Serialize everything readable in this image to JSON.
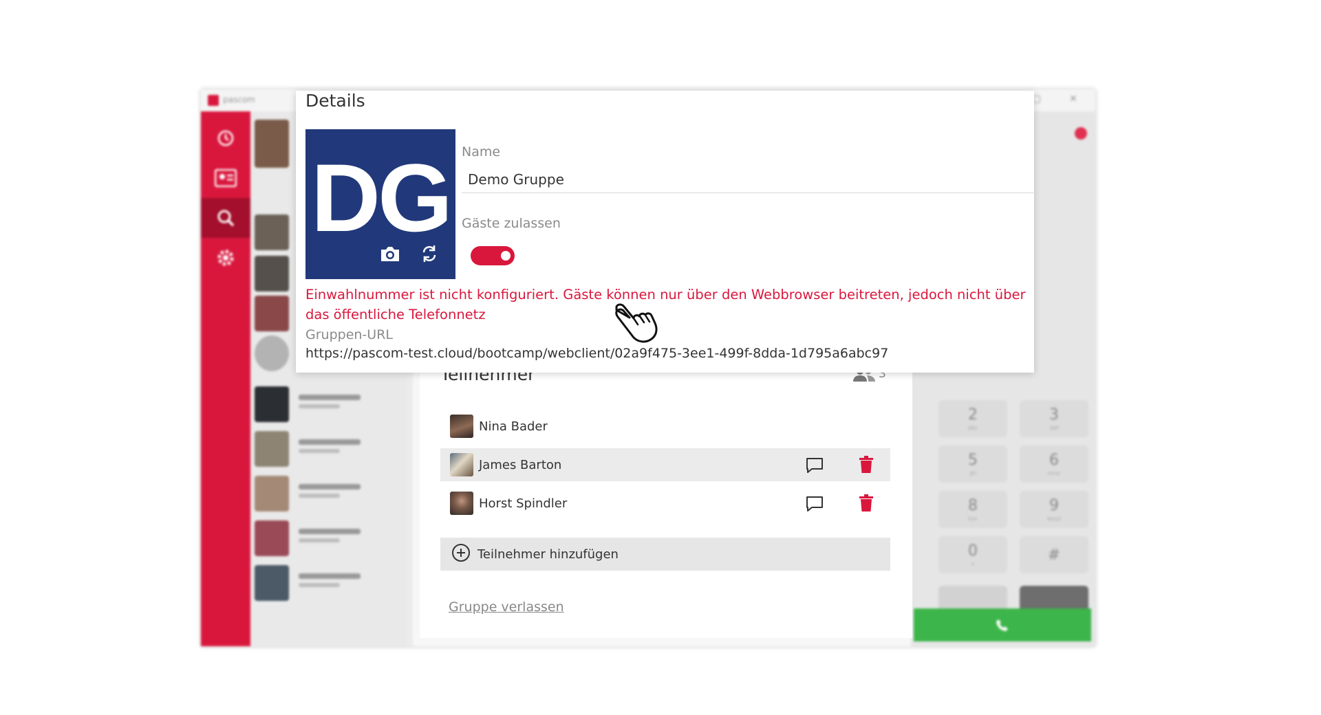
{
  "app": {
    "logo_text": "pascom"
  },
  "window": {
    "maximize_glyph": "▢",
    "close_glyph": "✕"
  },
  "details": {
    "title": "Details",
    "avatar_initials": "DG",
    "name_label": "Name",
    "name_value": "Demo Gruppe",
    "guests_label": "Gäste zulassen",
    "guests_enabled": true,
    "warning": "Einwahlnummer ist nicht konfiguriert. Gäste können nur über den Webbrowser beitreten, jedoch nicht über das öffentliche Telefonnetz",
    "url_label": "Gruppen-URL",
    "url_value": "https://pascom-test.cloud/bootcamp/webclient/02a9f475-3ee1-499f-8dda-1d795a6abc97"
  },
  "participants": {
    "title": "Teilnehmer",
    "count": "3",
    "members": [
      {
        "name": "Nina Bader"
      },
      {
        "name": "James Barton"
      },
      {
        "name": "Horst Spindler"
      }
    ],
    "add_label": "Teilnehmer hinzufügen",
    "leave_label": "Gruppe verlassen"
  },
  "colors": {
    "accent": "#d9173d",
    "avatar_bg": "#21397a",
    "call_green": "#3cb54a"
  },
  "icons": [
    "history-icon",
    "contacts-icon",
    "search-icon",
    "gear-icon",
    "camera-icon",
    "refresh-icon",
    "users-icon",
    "chat-icon",
    "trash-icon",
    "add-circle-icon",
    "hand-cursor-icon"
  ]
}
